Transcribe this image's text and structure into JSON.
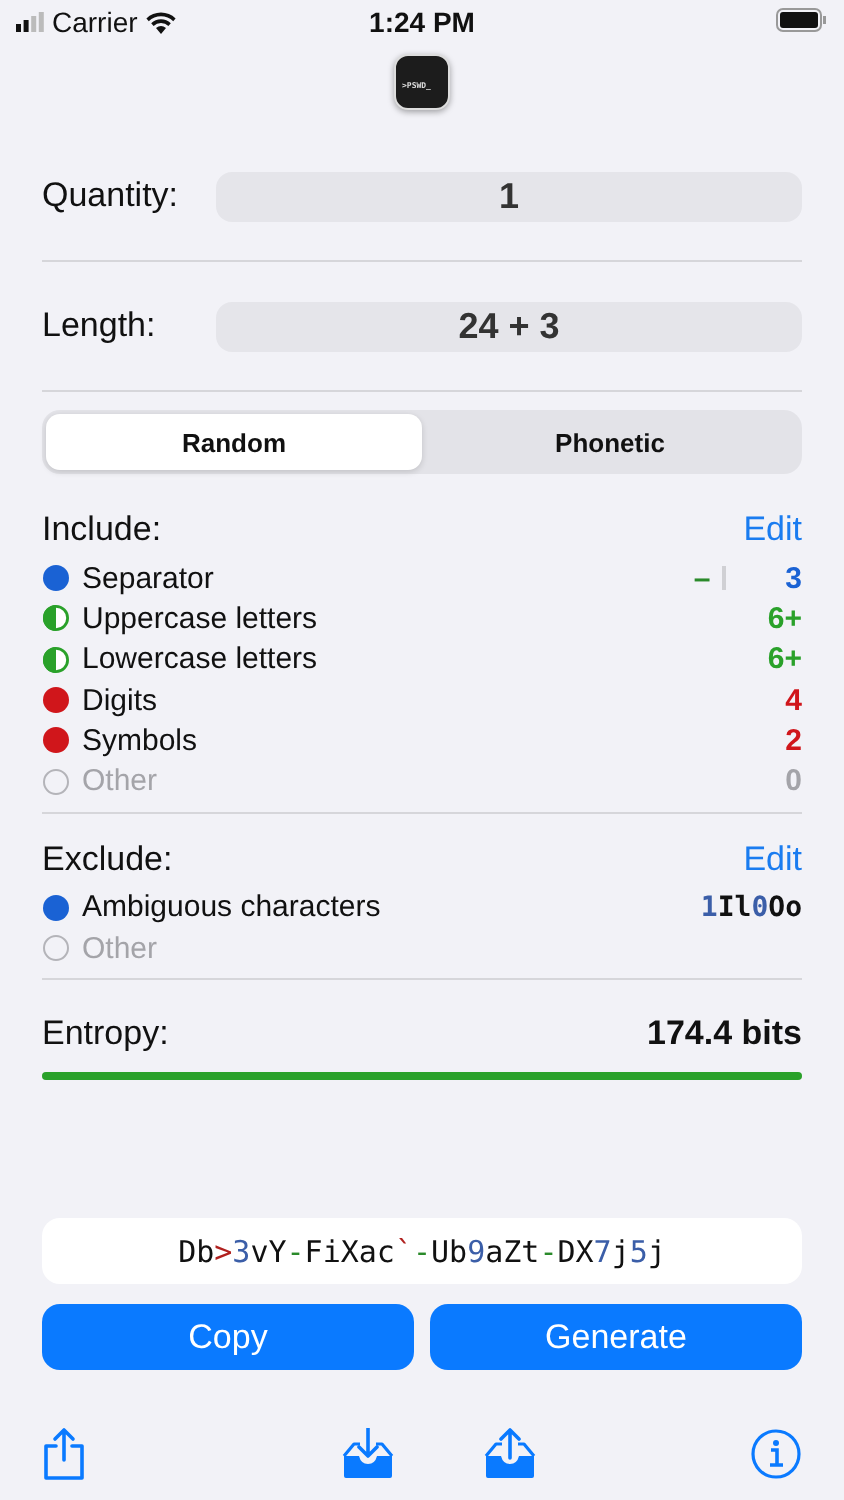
{
  "status_bar": {
    "carrier": "Carrier",
    "time": "1:24 PM"
  },
  "app_icon": {
    "label": ">PSWD_"
  },
  "pickers": [
    {
      "label": "Quantity:",
      "value": "1"
    },
    {
      "label": "Length:",
      "value": "24 + 3"
    }
  ],
  "mode_tabs": [
    {
      "label": "Random",
      "selected": true
    },
    {
      "label": "Phonetic",
      "selected": false
    }
  ],
  "include": {
    "title": "Include:",
    "edit": "Edit",
    "items": [
      {
        "name": "Separator",
        "kind": "full",
        "color": "#1a62d4",
        "value": "3",
        "separator_sample": "–",
        "disabled": false
      },
      {
        "name": "Uppercase letters",
        "kind": "half",
        "color": "#2aa12a",
        "value": "6+",
        "disabled": false
      },
      {
        "name": "Lowercase letters",
        "kind": "half",
        "color": "#2aa12a",
        "value": "6+",
        "disabled": false
      },
      {
        "name": "Digits",
        "kind": "full",
        "color": "#d0161b",
        "value": "4",
        "disabled": false
      },
      {
        "name": "Symbols",
        "kind": "full",
        "color": "#d0161b",
        "value": "2",
        "disabled": false
      },
      {
        "name": "Other",
        "kind": "empty",
        "color": "#b4b4b9",
        "value": "0",
        "disabled": true
      }
    ]
  },
  "exclude": {
    "title": "Exclude:",
    "edit": "Edit",
    "items": [
      {
        "name": "Ambiguous characters",
        "kind": "full",
        "color": "#1a62d4",
        "disabled": false,
        "value_parts": [
          {
            "text": "1",
            "color": "#3b5ea8"
          },
          {
            "text": "Il",
            "color": "#111111"
          },
          {
            "text": "0",
            "color": "#3b5ea8"
          },
          {
            "text": "Oo",
            "color": "#111111"
          }
        ]
      },
      {
        "name": "Other",
        "kind": "empty",
        "color": "#b4b4b9",
        "disabled": true
      }
    ]
  },
  "entropy": {
    "label": "Entropy:",
    "value": "174.4 bits",
    "level": 1.0,
    "color": "#2aa12a"
  },
  "password": {
    "parts": [
      {
        "text": "Db",
        "color": "#111111"
      },
      {
        "text": ">",
        "color": "#b0201e"
      },
      {
        "text": "3",
        "color": "#3b5ea8"
      },
      {
        "text": "vY",
        "color": "#111111"
      },
      {
        "text": "-",
        "color": "#2a8a2a"
      },
      {
        "text": "FiXac",
        "color": "#111111"
      },
      {
        "text": "`",
        "color": "#b0201e"
      },
      {
        "text": "-",
        "color": "#2a8a2a"
      },
      {
        "text": "Ub",
        "color": "#111111"
      },
      {
        "text": "9",
        "color": "#3b5ea8"
      },
      {
        "text": "aZt",
        "color": "#111111"
      },
      {
        "text": "-",
        "color": "#2a8a2a"
      },
      {
        "text": "DX",
        "color": "#111111"
      },
      {
        "text": "7",
        "color": "#3b5ea8"
      },
      {
        "text": "j",
        "color": "#111111"
      },
      {
        "text": "5",
        "color": "#3b5ea8"
      },
      {
        "text": "j",
        "color": "#111111"
      }
    ]
  },
  "buttons": [
    {
      "label": "Copy"
    },
    {
      "label": "Generate"
    }
  ]
}
